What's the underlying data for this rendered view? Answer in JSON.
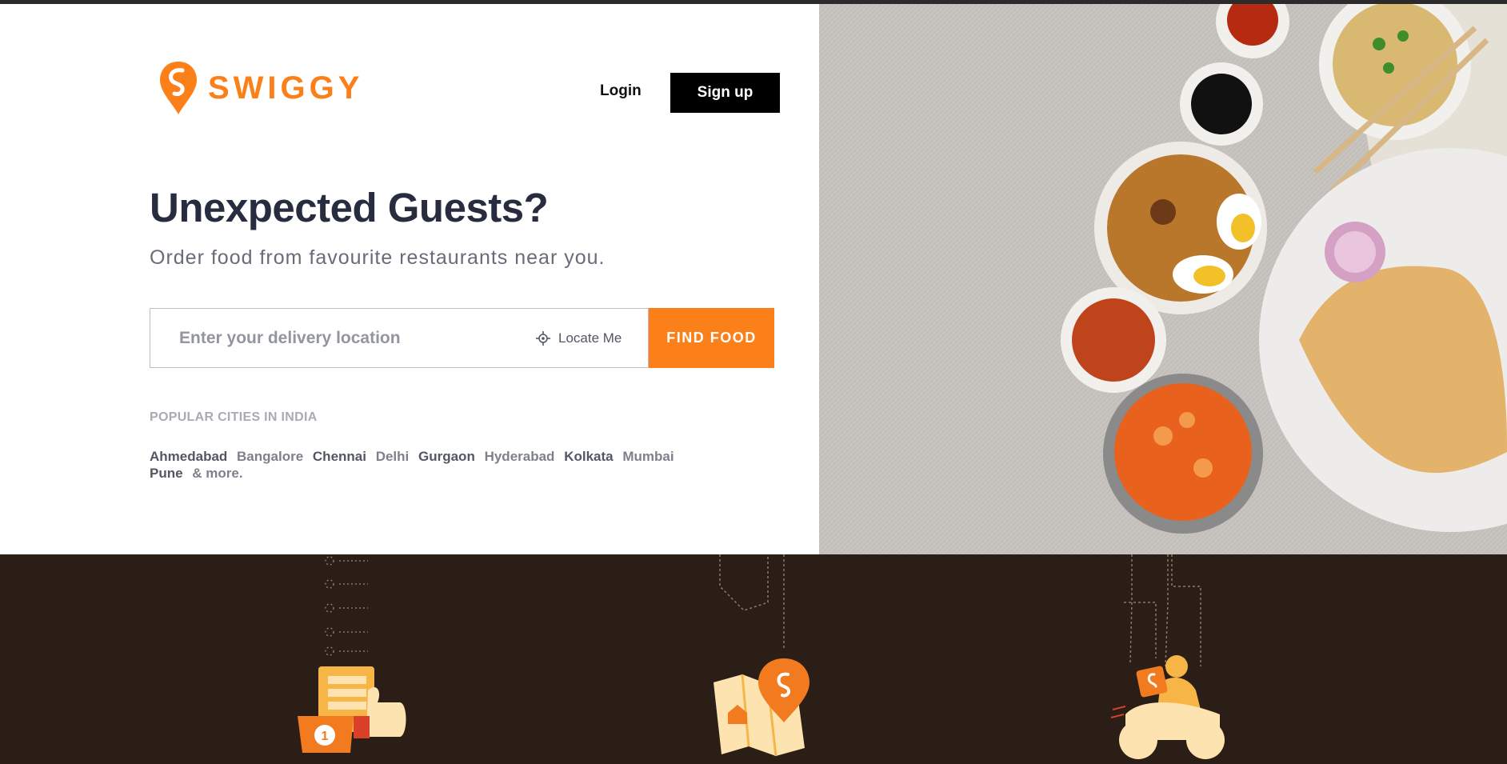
{
  "brand": {
    "name": "SWIGGY",
    "accent": "#fc8019"
  },
  "header": {
    "login_label": "Login",
    "signup_label": "Sign up"
  },
  "hero": {
    "title": "Unexpected Guests?",
    "subtitle": "Order food from favourite restaurants near you."
  },
  "search": {
    "placeholder": "Enter your delivery location",
    "value": "",
    "locate_label": "Locate Me",
    "button_label": "FIND FOOD"
  },
  "popular": {
    "title": "POPULAR CITIES IN INDIA",
    "cities": [
      "Ahmedabad",
      "Bangalore",
      "Chennai",
      "Delhi",
      "Gurgaon",
      "Hyderabad",
      "Kolkata",
      "Mumbai",
      "Pune"
    ],
    "more_label": "& more."
  },
  "colors": {
    "dark_bg": "#2b1e16",
    "button_dark": "#000000",
    "heading": "#282c3f"
  },
  "icons": [
    "swiggy-logo-icon",
    "locate-crosshair-icon",
    "order-list-thumbs-up-icon",
    "map-pin-icon",
    "delivery-scooter-icon"
  ]
}
